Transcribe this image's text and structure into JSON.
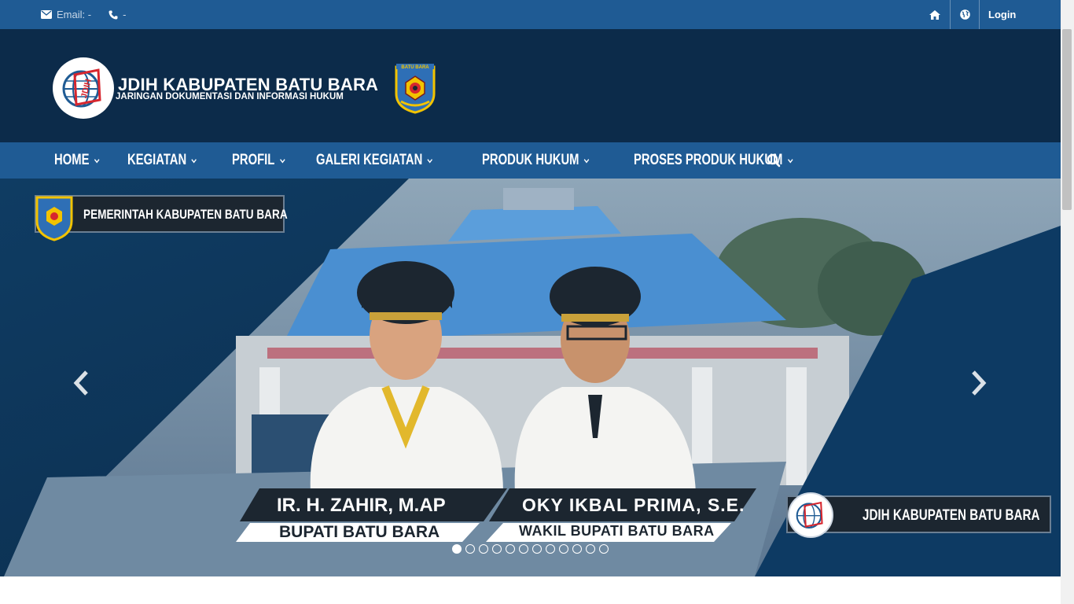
{
  "topbar": {
    "email_label": "Email: -",
    "phone_label": "-",
    "login_label": "Login",
    "icons": [
      "envelope-icon",
      "phone-icon",
      "home-icon",
      "globe-icon"
    ]
  },
  "header": {
    "title": "JDIH KABUPATEN BATU BARA",
    "subtitle": "JARINGAN DOKUMENTASI DAN INFORMASI HUKUM",
    "emblem_text": "BATU BARA",
    "logo_text": "JDIH"
  },
  "nav": {
    "items": [
      {
        "label": "HOME"
      },
      {
        "label": "KEGIATAN"
      },
      {
        "label": "PROFIL"
      },
      {
        "label": "GALERI KEGIATAN"
      },
      {
        "label": "PRODUK HUKUM"
      },
      {
        "label": "PROSES PRODUK HUKUM"
      }
    ]
  },
  "slider": {
    "top_badge": "PEMERINTAH KABUPATEN BATU BARA",
    "person_1_name": "IR. H. ZAHIR, M.AP",
    "person_1_title": "BUPATI BATU BARA",
    "person_2_name": "OKY IKBAL PRIMA, S.E.",
    "person_2_title": "WAKIL BUPATI BATU BARA",
    "bottom_badge": "JDIH KABUPATEN BATU BARA",
    "slide_count": 12,
    "active_slide": 1
  },
  "colors": {
    "topbar": "#1f5b94",
    "header": "#0c2b4a",
    "nav": "#1f5b94"
  }
}
